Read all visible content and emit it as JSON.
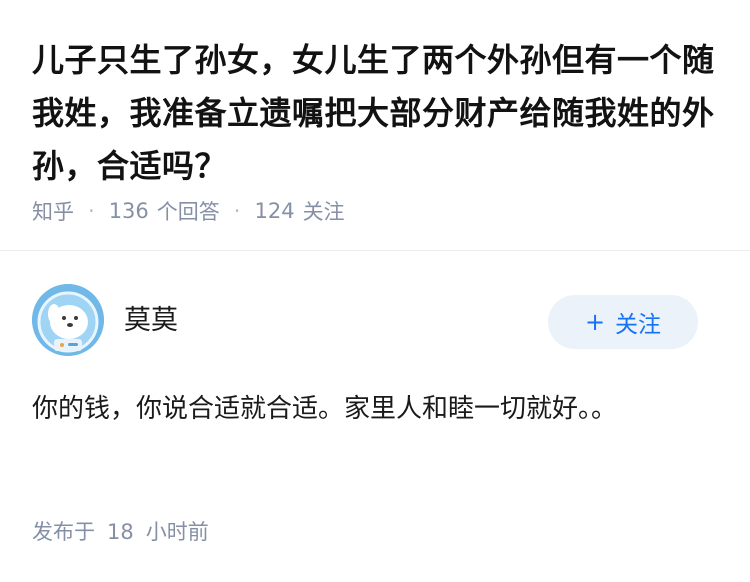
{
  "question": {
    "title": "儿子只生了孙女，女儿生了两个外孙但有一个随我姓，我准备立遗嘱把大部分财产给随我姓的外孙，合适吗？",
    "source": "知乎",
    "answer_count": "136",
    "answer_label": "个回答",
    "follower_count": "124",
    "follower_label": "关注"
  },
  "answer": {
    "author_name": "莫莫",
    "follow_label": "关注",
    "follow_icon": "+",
    "content": "你的钱，你说合适就合适。家里人和睦一切就好。。",
    "published_prefix": "发布于",
    "published_value": "18",
    "published_unit": "小时前"
  },
  "colors": {
    "accent": "#1772f6",
    "meta_gray": "#8590a6",
    "follow_bg": "#ebf2fa",
    "avatar_bg": "#6fb8e8"
  },
  "icons": {
    "avatar": "dog-astronaut-avatar",
    "follow": "plus-icon"
  }
}
